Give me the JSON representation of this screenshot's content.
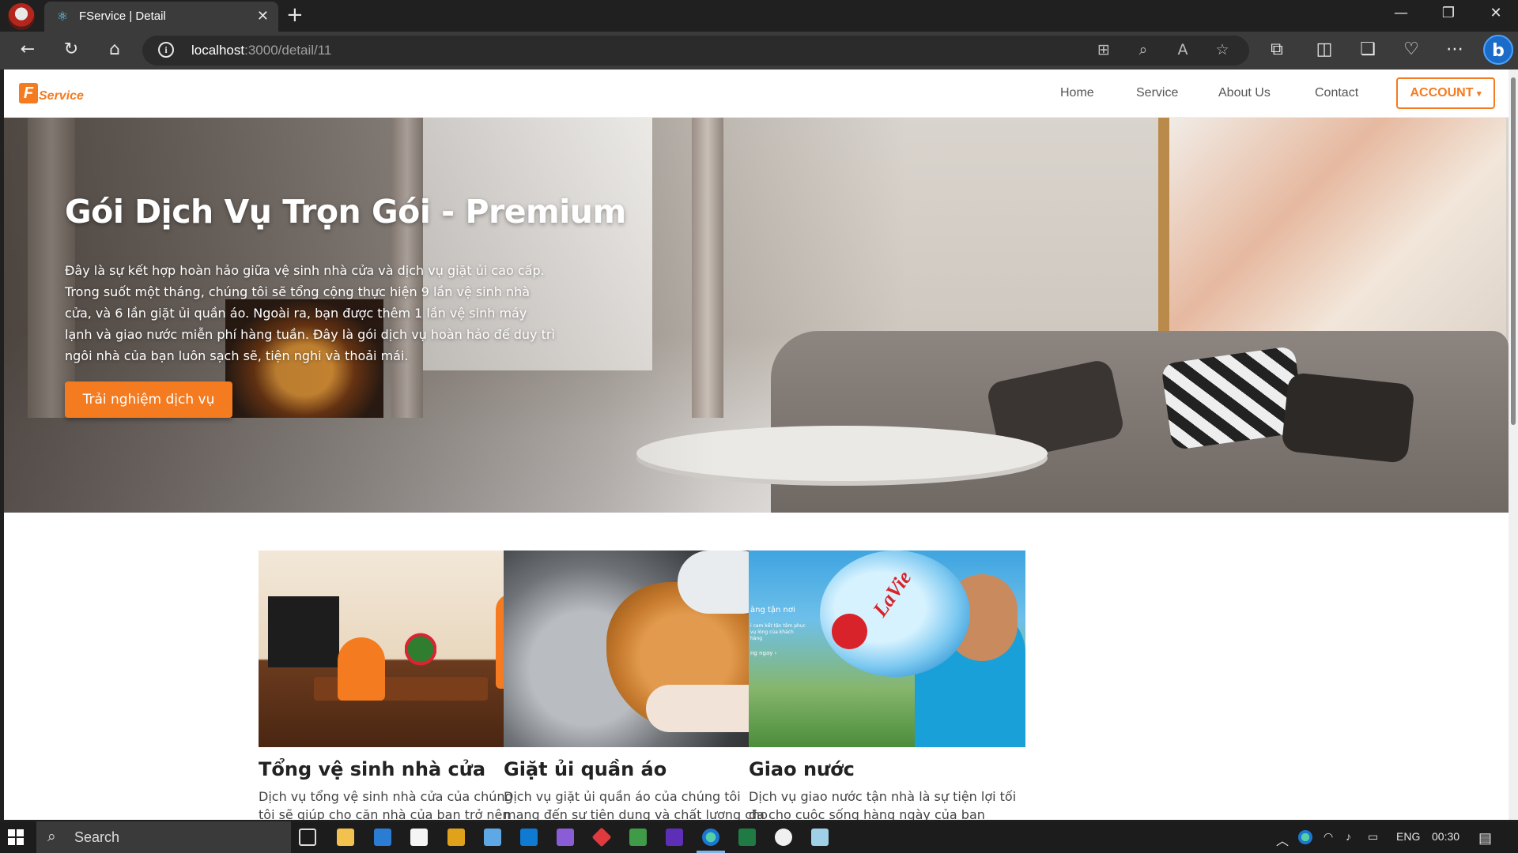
{
  "browser": {
    "tab_title": "FService | Detail",
    "url_host": "localhost",
    "url_rest": ":3000/detail/11"
  },
  "site": {
    "logo_letter": "F",
    "logo_text": "Service",
    "nav": [
      "Home",
      "Service",
      "About Us",
      "Contact"
    ],
    "account_label": "ACCOUNT",
    "account_caret": "▾",
    "accent_color": "#f47b20"
  },
  "hero": {
    "title": "Gói Dịch Vụ Trọn Gói - Premium",
    "description": "Đây là sự kết hợp hoàn hảo giữa vệ sinh nhà cửa và dịch vụ giặt ủi cao cấp. Trong suốt một tháng, chúng tôi sẽ tổng cộng thực hiện 9 lần vệ sinh nhà cửa, và 6 lần giặt ủi quần áo. Ngoài ra, bạn được thêm 1 lần vệ sinh máy lạnh và giao nước miễn phí hàng tuần. Đây là gói dịch vụ hoàn hảo để duy trì ngôi nhà của bạn luôn sạch sẽ, tiện nghi và thoải mái.",
    "cta_label": "Trải nghiệm dịch vụ"
  },
  "cards": [
    {
      "title": "Tổng vệ sinh nhà cửa",
      "desc": "Dịch vụ tổng vệ sinh nhà cửa của chúng tôi sẽ giúp cho căn nhà của bạn trở nên"
    },
    {
      "title": "Giặt ủi quần áo",
      "desc": "Dịch vụ giặt ủi quần áo của chúng tôi mang đến sự tiện dụng và chất lượng cho"
    },
    {
      "title": "Giao nước",
      "desc": "Dịch vụ giao nước tận nhà là sự tiện lợi tối đa cho cuộc sống hàng ngày của bạn",
      "img_text_1": "àng tận nơi",
      "img_text_2": "i cam kết tận tâm phục vụ lòng của khách hàng",
      "img_text_3": "ng ngay ›",
      "img_brand": "LaVie"
    }
  ],
  "taskbar": {
    "search_label": "Search",
    "lang": "ENG",
    "time": "00:30"
  }
}
